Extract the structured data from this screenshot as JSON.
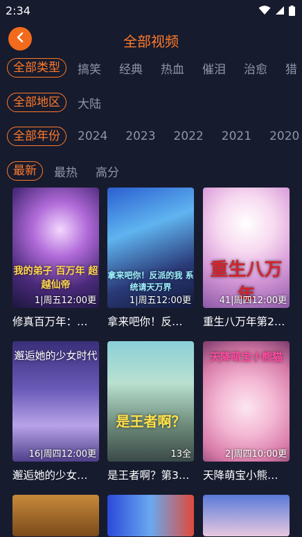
{
  "status": {
    "time": "2:34"
  },
  "header": {
    "title": "全部视频"
  },
  "filters": {
    "type": {
      "selected": "全部类型",
      "options": [
        "搞笑",
        "经典",
        "热血",
        "催泪",
        "治愈",
        "猎"
      ]
    },
    "region": {
      "selected": "全部地区",
      "options": [
        "大陆"
      ]
    },
    "year": {
      "selected": "全部年份",
      "options": [
        "2024",
        "2023",
        "2022",
        "2021",
        "2020"
      ]
    },
    "sort": {
      "selected": "最新",
      "options": [
        "最热",
        "高分"
      ]
    }
  },
  "videos": [
    {
      "title": "修真百万年：…",
      "episode": "1|周五12:00更",
      "art_text": "我的弟子 百万年 超越仙帝"
    },
    {
      "title": "拿来吧你！反…",
      "episode": "1|周五12:00更",
      "art_text": "拿来吧你！反派的我 系统请天万界"
    },
    {
      "title": "重生八万年第2…",
      "episode": "41|周四12:00更",
      "art_text": "重生八万年"
    },
    {
      "title": "邂逅她的少女…",
      "episode": "16|周四12:00更",
      "art_text": "邂逅她的少女时代"
    },
    {
      "title": "是王者啊？第3…",
      "episode": "13全",
      "art_text": "是王者啊？"
    },
    {
      "title": "天降萌宝小熊…",
      "episode": "2|周四10:00更",
      "art_text": "天降萌宝小熊猫"
    }
  ],
  "colors": {
    "accent": "#ff7a2a",
    "background": "#171b2e"
  }
}
